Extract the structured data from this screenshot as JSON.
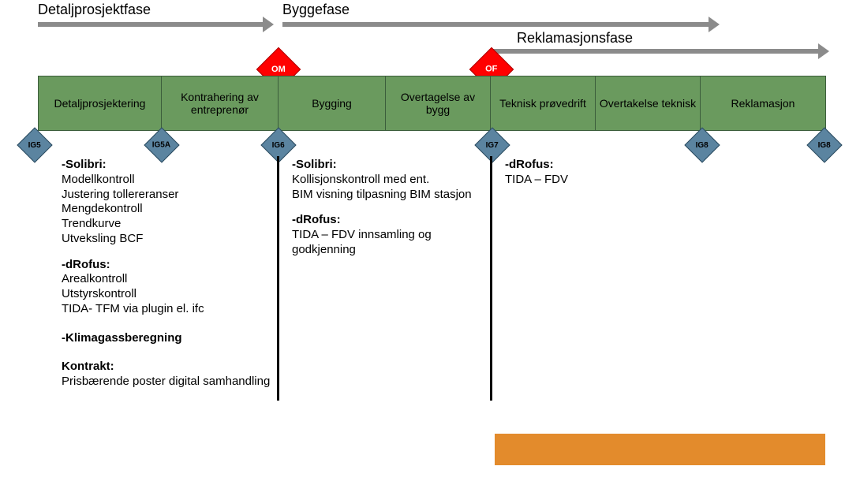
{
  "topArrows": [
    {
      "label": "Detaljprosjektfase"
    },
    {
      "label": "Byggefase"
    },
    {
      "label": "Reklamasjonsfase"
    }
  ],
  "redMilestones": [
    {
      "code": "OM"
    },
    {
      "code": "OF"
    }
  ],
  "phases": [
    {
      "label": "Detaljprosjektering"
    },
    {
      "label": "Kontrahering av entreprenør"
    },
    {
      "label": "Bygging"
    },
    {
      "label": "Overtagelse av bygg"
    },
    {
      "label": "Teknisk prøvedrift"
    },
    {
      "label": "Overtakelse teknisk"
    },
    {
      "label": "Reklamasjon"
    }
  ],
  "gates": [
    {
      "code": "IG5"
    },
    {
      "code": "IG5A"
    },
    {
      "code": "IG6"
    },
    {
      "code": "IG7"
    },
    {
      "code": "IG8"
    },
    {
      "code": "IG8"
    }
  ],
  "col1": {
    "h1": "-Solibri:",
    "l1": "Modellkontroll",
    "l2": "Justering tollereranser",
    "l3": "Mengdekontroll",
    "l4": "Trendkurve",
    "l5": "Utveksling BCF",
    "h2": "-dRofus:",
    "l6": "Arealkontroll",
    "l7": "Utstyrskontroll",
    "l8": "TIDA-  TFM via plugin el. ifc",
    "h3": "-Klimagassberegning",
    "h4": "Kontrakt:",
    "l9": "Prisbærende poster digital samhandling"
  },
  "col2": {
    "h1": "-Solibri:",
    "l1": "Kollisjonskontroll med ent.",
    "l2": "BIM visning tilpasning BIM stasjon",
    "h2": "-dRofus:",
    "l3": "TIDA – FDV innsamling og godkjenning"
  },
  "col3": {
    "h1": "-dRofus:",
    "l1": "TIDA – FDV"
  }
}
